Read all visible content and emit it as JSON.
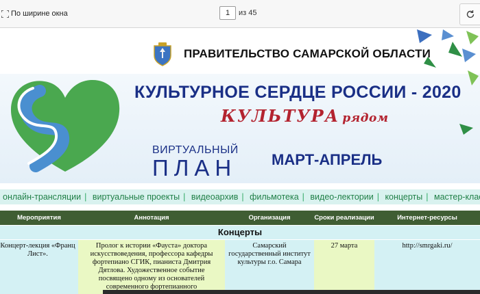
{
  "toolbar": {
    "fit_label": "По ширине окна",
    "page_current": "1",
    "page_total_label": "из 45"
  },
  "header": {
    "government": "ПРАВИТЕЛЬСТВО САМАРСКОЙ ОБЛАСТИ",
    "title": "КУЛЬТУРНОЕ СЕРДЦЕ РОССИИ - 2020",
    "slogan_main": "КУЛЬТУРА",
    "slogan_sub": "рядом",
    "virtual": "ВИРТУАЛЬНЫЙ",
    "plan": "ПЛАН",
    "period": "МАРТ-АПРЕЛЬ"
  },
  "categories": [
    "онлайн-трансляции",
    "виртуальные проекты",
    "видеоархив",
    "фильмотека",
    "видео-лектории",
    "концерты",
    "мастер-классы"
  ],
  "table": {
    "headers": [
      "Мероприятия",
      "Аннотация",
      "Организация",
      "Сроки реализации",
      "Интернет-ресурсы"
    ],
    "section": "Концерты",
    "row": {
      "event": "Концерт-лекция «Франц Лист».",
      "annotation": "Пролог к истории «Фауста» доктора искусствоведения, профессора кафедры фортепиано СГИК, пианиста Дмитрия Дятлова. Художественное событие посвящено одному из основателей современного фортепианного",
      "organization": "Самарский государственный институт культуры г.о. Самара",
      "date": "27 марта",
      "resource": "http://smrgaki.ru/"
    }
  },
  "colors": {
    "title_blue": "#1a2f86",
    "slogan_red": "#b3232f",
    "heart_green": "#4aa84f",
    "river_blue": "#4a8fd0",
    "header_green": "#3f5d33",
    "cyan_cell": "#d4f1f4",
    "lime_cell": "#eaf8c4",
    "link_green": "#1f7f46"
  }
}
